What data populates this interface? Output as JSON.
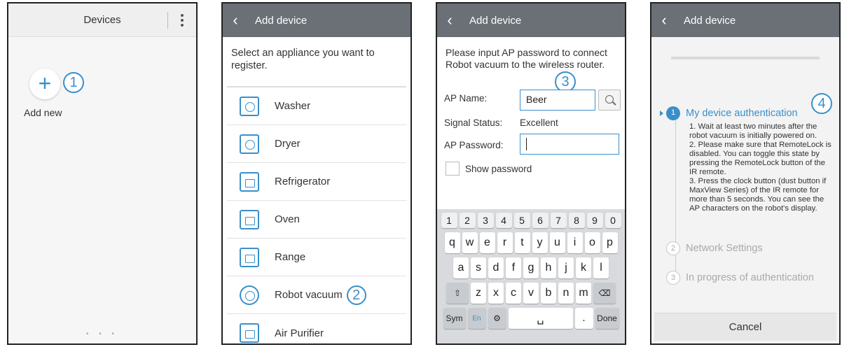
{
  "panel1": {
    "title": "Devices",
    "add_label": "Add new",
    "plus": "+",
    "marker": "1",
    "page_dots": "• • •"
  },
  "panel2": {
    "title": "Add device",
    "intro": "Select an appliance you want to register.",
    "marker": "2",
    "items": [
      {
        "label": "Washer",
        "icon": "washer-icon"
      },
      {
        "label": "Dryer",
        "icon": "dryer-icon"
      },
      {
        "label": "Refrigerator",
        "icon": "refrigerator-icon"
      },
      {
        "label": "Oven",
        "icon": "oven-icon"
      },
      {
        "label": "Range",
        "icon": "range-icon"
      },
      {
        "label": "Robot vacuum",
        "icon": "robot-vacuum-icon"
      },
      {
        "label": "Air Purifier",
        "icon": "air-purifier-icon"
      }
    ]
  },
  "panel3": {
    "title": "Add device",
    "intro": "Please input AP password to connect Robot vacuum to the wireless router.",
    "marker": "3",
    "ap_name_label": "AP Name:",
    "ap_name_value": "Beer",
    "signal_label": "Signal Status:",
    "signal_value": "Excellent",
    "password_label": "AP Password:",
    "password_value": "",
    "show_password": "Show password",
    "keyboard": {
      "numbers": [
        "1",
        "2",
        "3",
        "4",
        "5",
        "6",
        "7",
        "8",
        "9",
        "0"
      ],
      "row1": [
        "q",
        "w",
        "e",
        "r",
        "t",
        "y",
        "u",
        "i",
        "o",
        "p"
      ],
      "row2": [
        "a",
        "s",
        "d",
        "f",
        "g",
        "h",
        "j",
        "k",
        "l"
      ],
      "row3": [
        "z",
        "x",
        "c",
        "v",
        "b",
        "n",
        "m"
      ],
      "sym": "Sym",
      "lang": "En",
      "done": "Done",
      "period": "."
    }
  },
  "panel4": {
    "title": "Add device",
    "marker": "4",
    "steps": [
      {
        "num": "1",
        "label": "My device authentication",
        "state": "active"
      },
      {
        "num": "2",
        "label": "Network Settings",
        "state": "idle"
      },
      {
        "num": "3",
        "label": "In progress of authentication",
        "state": "idle"
      }
    ],
    "instructions": [
      "1. Wait at least two minutes after the robot vacuum is initially powered on.",
      "2. Please make sure that RemoteLock is disabled. You can toggle this state by pressing the RemoteLock button of the IR remote.",
      "3. Press the clock button (dust button if MaxView Series) of the IR remote for more than 5 seconds. You can see the AP characters on the robot's display."
    ],
    "cancel": "Cancel"
  },
  "colors": {
    "accent": "#3a8fc9",
    "header": "#6a7076",
    "keyboard": "#d8dadd"
  }
}
